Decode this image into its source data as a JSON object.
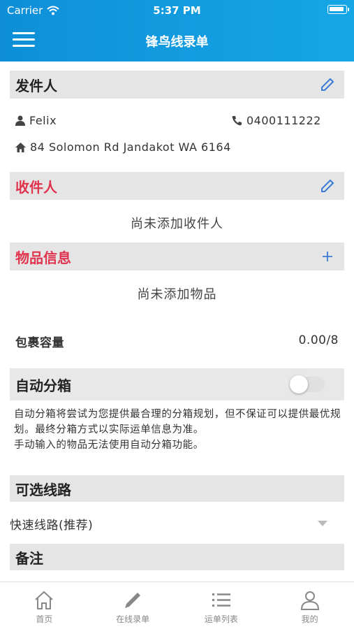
{
  "status_bar": {
    "carrier": "Carrier",
    "time": "5:37 PM"
  },
  "header": {
    "title": "锋鸟线录单"
  },
  "sender": {
    "section_title": "发件人",
    "name": "Felix",
    "phone": "0400111222",
    "address": "84 Solomon Rd Jandakot WA 6164"
  },
  "receiver": {
    "section_title": "收件人",
    "empty_text": "尚未添加收件人"
  },
  "items": {
    "section_title": "物品信息",
    "empty_text": "尚未添加物品"
  },
  "package": {
    "label": "包裹容量",
    "value": "0.00/8"
  },
  "auto_box": {
    "label": "自动分箱",
    "enabled": false,
    "desc_line1": "自动分箱将尝试为您提供最合理的分箱规划，但不保证可以提供最优规划。最终分箱方式以实际运单信息为准。",
    "desc_line2": "手动输入的物品无法使用自动分箱功能。"
  },
  "route": {
    "section_title": "可选线路",
    "selected": "快速线路(推荐)"
  },
  "remark": {
    "section_title": "备注"
  },
  "tabbar": {
    "tabs": [
      {
        "label": "首页",
        "icon": "home-icon"
      },
      {
        "label": "在线录单",
        "icon": "pencil-icon"
      },
      {
        "label": "运单列表",
        "icon": "list-icon"
      },
      {
        "label": "我的",
        "icon": "user-icon"
      }
    ]
  },
  "colors": {
    "header": "#0e8fd8",
    "accent_red": "#e0344e",
    "action_blue": "#3a7bd5"
  }
}
